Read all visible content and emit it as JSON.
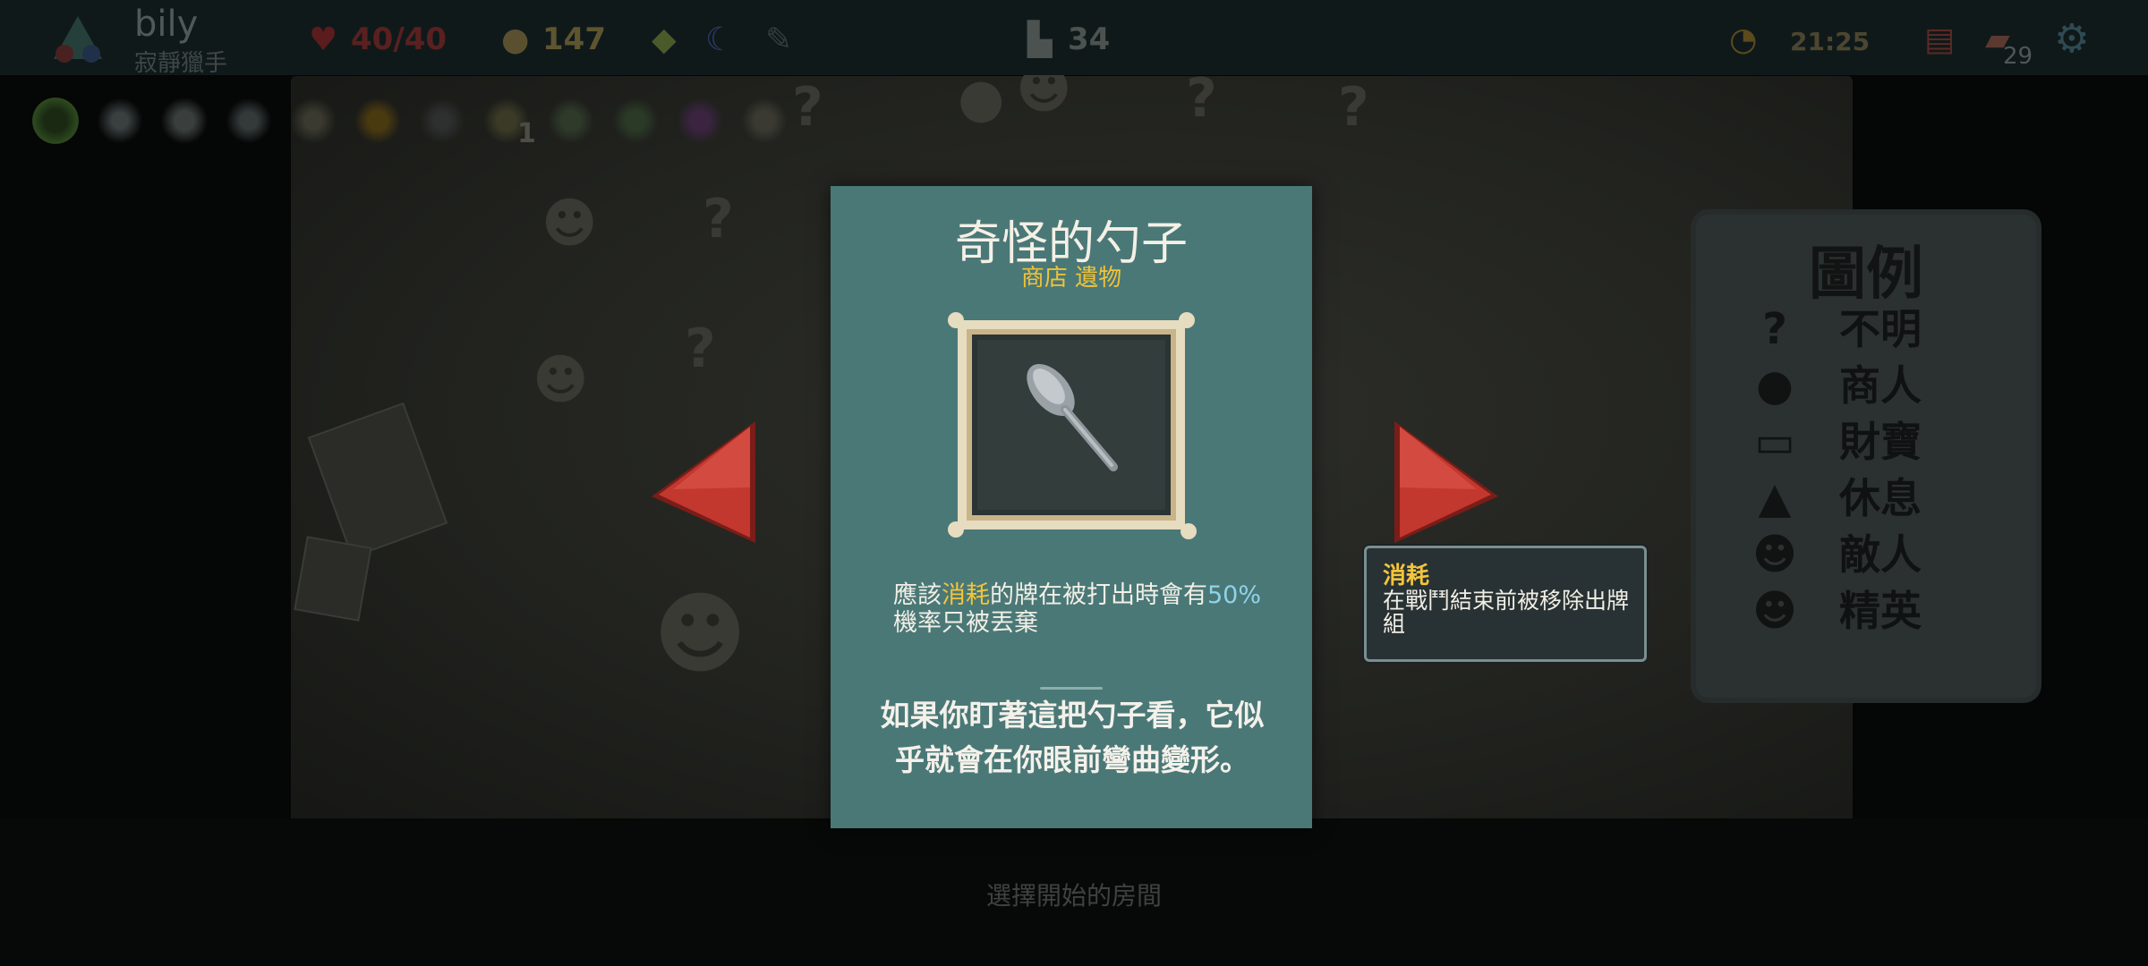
{
  "topbar": {
    "player_name": "bily",
    "player_class": "寂靜獵手",
    "hp": "40/40",
    "gold": "147",
    "floor": "34",
    "time": "21:25",
    "deck_count": "29"
  },
  "relic_strip": {
    "counter": "1"
  },
  "card": {
    "title": "奇怪的勺子",
    "subtitle": "商店 遺物",
    "desc_part1": "應該",
    "desc_keyword": "消耗",
    "desc_part2": "的牌在被打出時會有",
    "desc_percent": "50%",
    "desc_part3": "機率只被丟棄",
    "flavor": "如果你盯著這把勺子看，它似乎就會在你眼前彎曲變形。"
  },
  "tooltip": {
    "title": "消耗",
    "body": "在戰鬥結束前被移除出牌組"
  },
  "legend": {
    "title": "圖例",
    "items": [
      {
        "icon": "unknown-icon",
        "label": "不明"
      },
      {
        "icon": "merchant-icon",
        "label": "商人"
      },
      {
        "icon": "treasure-icon",
        "label": "財寶"
      },
      {
        "icon": "rest-icon",
        "label": "休息"
      },
      {
        "icon": "enemy-icon",
        "label": "敵人"
      },
      {
        "icon": "elite-icon",
        "label": "精英"
      }
    ]
  },
  "bottom_hint": "選擇開始的房間",
  "colors": {
    "card_bg": "#4a7877",
    "keyword_yellow": "#f2c53a",
    "keyword_blue": "#8fd3e8",
    "arrow_red": "#b8332c"
  }
}
